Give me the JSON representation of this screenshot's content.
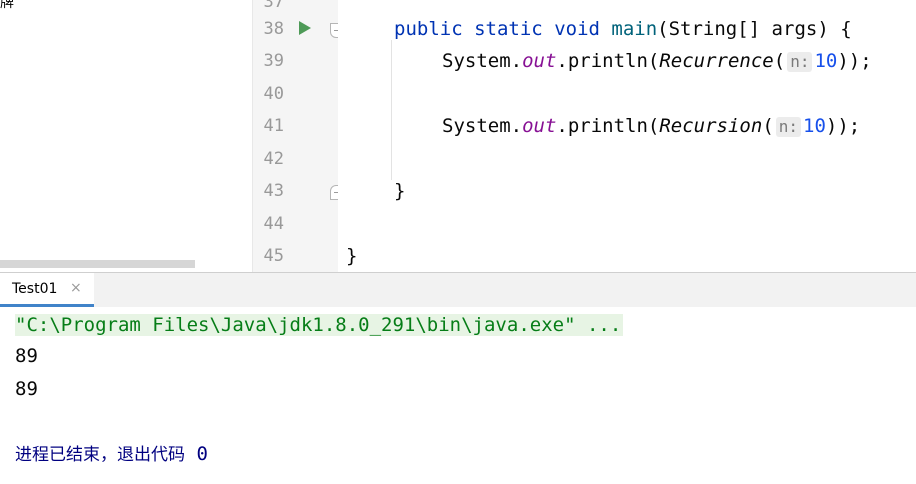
{
  "editor": {
    "left_stub_text": "牌",
    "line_numbers": [
      "37",
      "38",
      "39",
      "40",
      "41",
      "42",
      "43",
      "44",
      "45"
    ],
    "lines": {
      "l38": {
        "kw1": "public",
        "kw2": "static",
        "kw3": "void",
        "method": "main",
        "rest": "(String[] args) {"
      },
      "l39": {
        "obj": "System.",
        "field": "out",
        "call": ".println(",
        "method": "Recurrence",
        "paren": "(",
        "hint": "n:",
        "arg": "10",
        "tail": "));"
      },
      "l41": {
        "obj": "System.",
        "field": "out",
        "call": ".println(",
        "method": "Recursion",
        "paren": "(",
        "hint": "n:",
        "arg": "10",
        "tail": "));"
      },
      "l43": {
        "text": "}"
      },
      "l45": {
        "text": "}"
      }
    }
  },
  "run_window": {
    "tab_label": "Test01",
    "tab_close": "×",
    "command": "\"C:\\Program Files\\Java\\jdk1.8.0_291\\bin\\java.exe\" ...",
    "output_lines": [
      "89",
      "89"
    ],
    "exit_message": "进程已结束，退出代码",
    "exit_code": "0"
  },
  "colors": {
    "keyword": "#0033b3",
    "method": "#00627a",
    "static_field": "#871094",
    "number": "#1750eb",
    "command_text": "#067d17",
    "exit_text": "#000080",
    "run_icon": "#4e9a57"
  }
}
